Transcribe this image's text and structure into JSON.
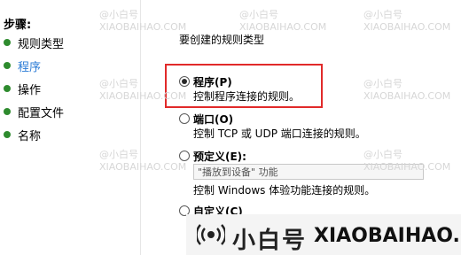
{
  "steps": {
    "title": "步骤:",
    "items": [
      {
        "label": "规则类型",
        "color": "#2e8b2e"
      },
      {
        "label": "程序",
        "color": "#2e8b2e"
      },
      {
        "label": "操作",
        "color": "#2e8b2e"
      },
      {
        "label": "配置文件",
        "color": "#2e8b2e"
      },
      {
        "label": "名称",
        "color": "#2e8b2e"
      }
    ]
  },
  "main": {
    "prompt": "要创建的规则类型",
    "options": [
      {
        "label": "程序(P)",
        "desc": "控制程序连接的规则。",
        "selected": true
      },
      {
        "label": "端口(O)",
        "desc": "控制 TCP 或 UDP 端口连接的规则。",
        "selected": false
      },
      {
        "label": "预定义(E):",
        "desc": "控制 Windows 体验功能连接的规则。",
        "selected": false,
        "select_value": "\"播放到设备\" 功能"
      },
      {
        "label": "自定义(C)",
        "desc": "",
        "selected": false
      }
    ]
  },
  "watermark": {
    "cn": "小白号",
    "en": "XIAOBAIHAO.COM",
    "tile_cn": "@小白号",
    "tile_en": "XIAOBAIHAO.COM"
  }
}
